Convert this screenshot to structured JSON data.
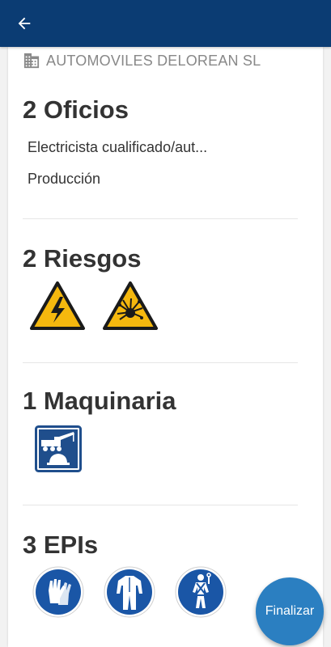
{
  "header": {
    "back_icon": "arrow-left-icon",
    "color": "#0b3c73"
  },
  "company": {
    "icon": "building-icon",
    "name": "AUTOMOVILES DELOREAN SL"
  },
  "oficios": {
    "title": "2 Oficios",
    "items": [
      "Electricista cualificado/aut...",
      "Producción"
    ]
  },
  "riesgos": {
    "title": "2 Riesgos",
    "icons": [
      "electrical-hazard-icon",
      "explosion-hazard-icon"
    ]
  },
  "maquinaria": {
    "title": "1 Maquinaria",
    "icons": [
      "crane-truck-icon"
    ]
  },
  "epis": {
    "title": "3 EPIs",
    "icons": [
      "gloves-icon",
      "coverall-icon",
      "safety-harness-icon"
    ]
  },
  "fab": {
    "label": "Finalizar",
    "color": "#2b7fc1"
  }
}
